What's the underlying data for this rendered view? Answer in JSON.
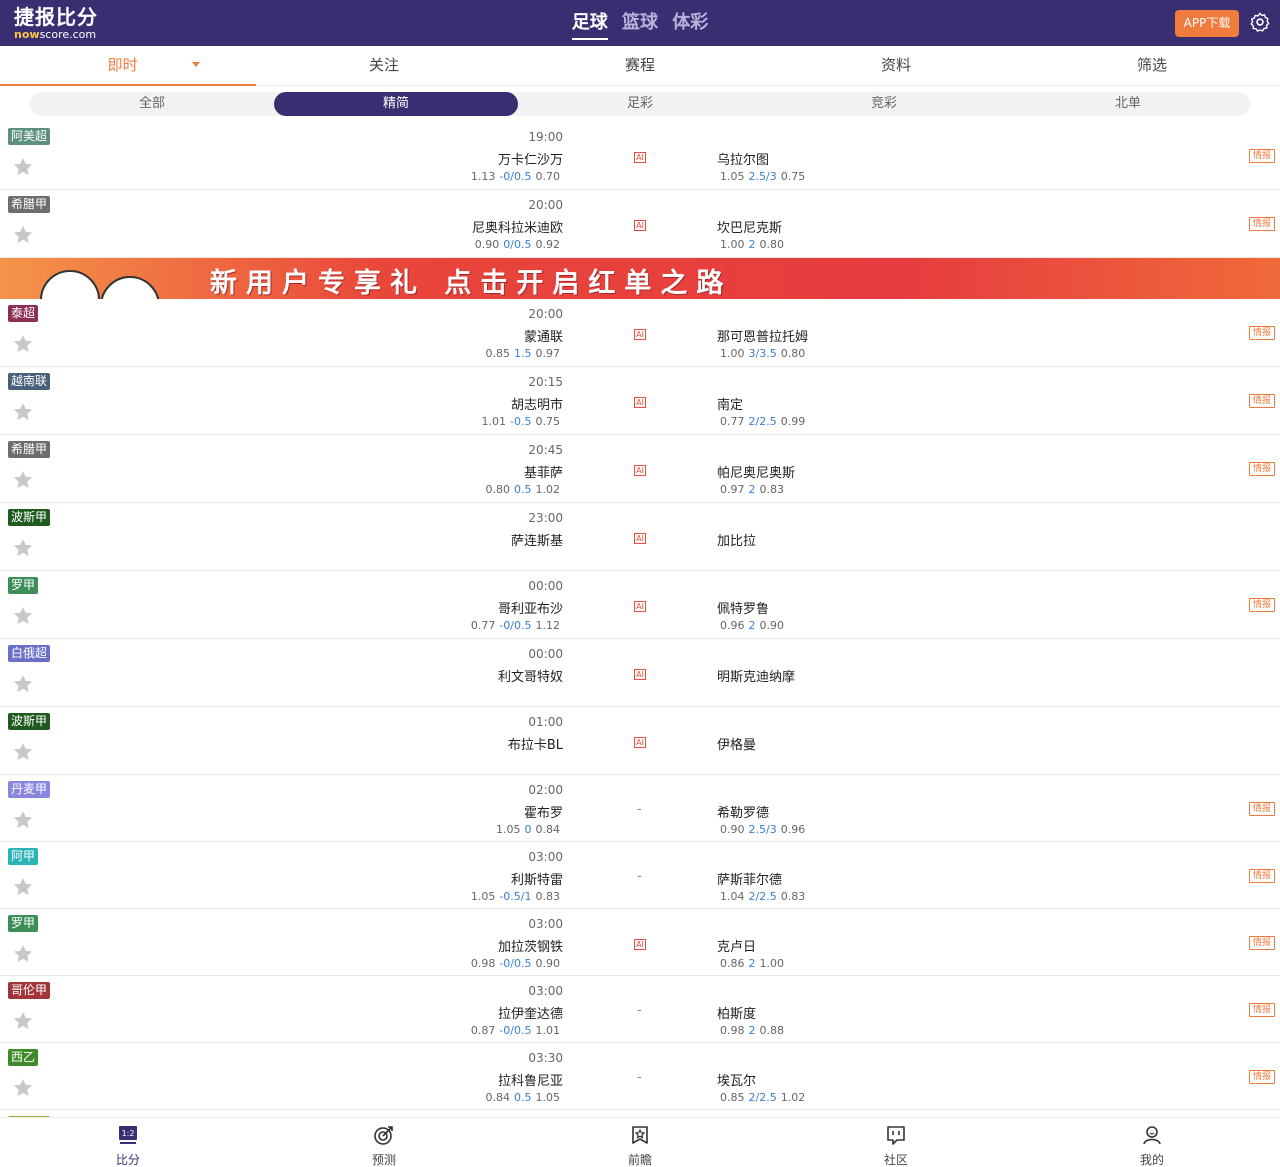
{
  "header": {
    "logo_cn": "捷报比分",
    "logo_en_prefix": "now",
    "logo_en_suffix": "score.com",
    "sports": [
      "足球",
      "篮球",
      "体彩"
    ],
    "active_sport": 0,
    "app_download": "APP下载"
  },
  "tabs": [
    "即时",
    "关注",
    "赛程",
    "资料",
    "筛选"
  ],
  "subtabs": [
    "全部",
    "精简",
    "足彩",
    "竞彩",
    "北单"
  ],
  "banner_text": "新用户专享礼 点击开启红单之路",
  "intel_label": "情报",
  "ai_label": "AI",
  "dash": "-",
  "matches": [
    {
      "league": "阿美超",
      "color": "#5c8f7f",
      "time": "19:00",
      "home": "万卡仁沙万",
      "away": "乌拉尔图",
      "h1": "1.13",
      "hl": "-0/0.5",
      "h2": "0.70",
      "a1": "1.05",
      "al": "2.5/3",
      "a2": "0.75",
      "ai": true,
      "intel": true
    },
    {
      "league": "希腊甲",
      "color": "#6d6d6d",
      "time": "20:00",
      "home": "尼奥科拉米迪欧",
      "away": "坎巴尼克斯",
      "h1": "0.90",
      "hl": "0/0.5",
      "h2": "0.92",
      "a1": "1.00",
      "al": "2",
      "a2": "0.80",
      "ai": true,
      "intel": true
    },
    {
      "league": "泰超",
      "color": "#8c2f55",
      "time": "20:00",
      "home": "蒙通联",
      "away": "那可恩普拉托姆",
      "h1": "0.85",
      "hl": "1.5",
      "h2": "0.97",
      "a1": "1.00",
      "al": "3/3.5",
      "a2": "0.80",
      "ai": true,
      "intel": true
    },
    {
      "league": "越南联",
      "color": "#4a5f7a",
      "time": "20:15",
      "home": "胡志明市",
      "away": "南定",
      "h1": "1.01",
      "hl": "-0.5",
      "h2": "0.75",
      "a1": "0.77",
      "al": "2/2.5",
      "a2": "0.99",
      "ai": true,
      "intel": true
    },
    {
      "league": "希腊甲",
      "color": "#6d6d6d",
      "time": "20:45",
      "home": "基菲萨",
      "away": "帕尼奥尼奥斯",
      "h1": "0.80",
      "hl": "0.5",
      "h2": "1.02",
      "a1": "0.97",
      "al": "2",
      "a2": "0.83",
      "ai": true,
      "intel": true
    },
    {
      "league": "波斯甲",
      "color": "#1f5a1f",
      "time": "23:00",
      "home": "萨连斯基",
      "away": "加比拉",
      "h1": "",
      "hl": "",
      "h2": "",
      "a1": "",
      "al": "",
      "a2": "",
      "ai": true,
      "intel": false
    },
    {
      "league": "罗甲",
      "color": "#3d8f5a",
      "time": "00:00",
      "home": "哥利亚布沙",
      "away": "佩特罗鲁",
      "h1": "0.77",
      "hl": "-0/0.5",
      "h2": "1.12",
      "a1": "0.96",
      "al": "2",
      "a2": "0.90",
      "ai": true,
      "intel": true
    },
    {
      "league": "白俄超",
      "color": "#6a6fc7",
      "time": "00:00",
      "home": "利文哥特奴",
      "away": "明斯克迪纳摩",
      "h1": "",
      "hl": "",
      "h2": "",
      "a1": "",
      "al": "",
      "a2": "",
      "ai": true,
      "intel": false
    },
    {
      "league": "波斯甲",
      "color": "#1f5a1f",
      "time": "01:00",
      "home": "布拉卡BL",
      "away": "伊格曼",
      "h1": "",
      "hl": "",
      "h2": "",
      "a1": "",
      "al": "",
      "a2": "",
      "ai": true,
      "intel": false
    },
    {
      "league": "丹麦甲",
      "color": "#8a86e0",
      "time": "02:00",
      "home": "霍布罗",
      "away": "希勒罗德",
      "h1": "1.05",
      "hl": "0",
      "h2": "0.84",
      "a1": "0.90",
      "al": "2.5/3",
      "a2": "0.96",
      "ai": false,
      "intel": true
    },
    {
      "league": "阿甲",
      "color": "#2bb3b5",
      "time": "03:00",
      "home": "利斯特雷",
      "away": "萨斯菲尔德",
      "h1": "1.05",
      "hl": "-0.5/1",
      "h2": "0.83",
      "a1": "1.04",
      "al": "2/2.5",
      "a2": "0.83",
      "ai": false,
      "intel": true
    },
    {
      "league": "罗甲",
      "color": "#3d8f5a",
      "time": "03:00",
      "home": "加拉茨钢铁",
      "away": "克卢日",
      "h1": "0.98",
      "hl": "-0/0.5",
      "h2": "0.90",
      "a1": "0.86",
      "al": "2",
      "a2": "1.00",
      "ai": true,
      "intel": true
    },
    {
      "league": "哥伦甲",
      "color": "#a2353a",
      "time": "03:00",
      "home": "拉伊奎达德",
      "away": "柏斯度",
      "h1": "0.87",
      "hl": "-0/0.5",
      "h2": "1.01",
      "a1": "0.98",
      "al": "2",
      "a2": "0.88",
      "ai": false,
      "intel": true
    },
    {
      "league": "西乙",
      "color": "#3f8a2a",
      "time": "03:30",
      "home": "拉科鲁尼亚",
      "away": "埃瓦尔",
      "h1": "0.84",
      "hl": "0.5",
      "h2": "1.05",
      "a1": "0.85",
      "al": "2/2.5",
      "a2": "1.02",
      "ai": false,
      "intel": true
    }
  ],
  "bottom_nav": [
    "比分",
    "预测",
    "前瞻",
    "社区",
    "我的"
  ]
}
